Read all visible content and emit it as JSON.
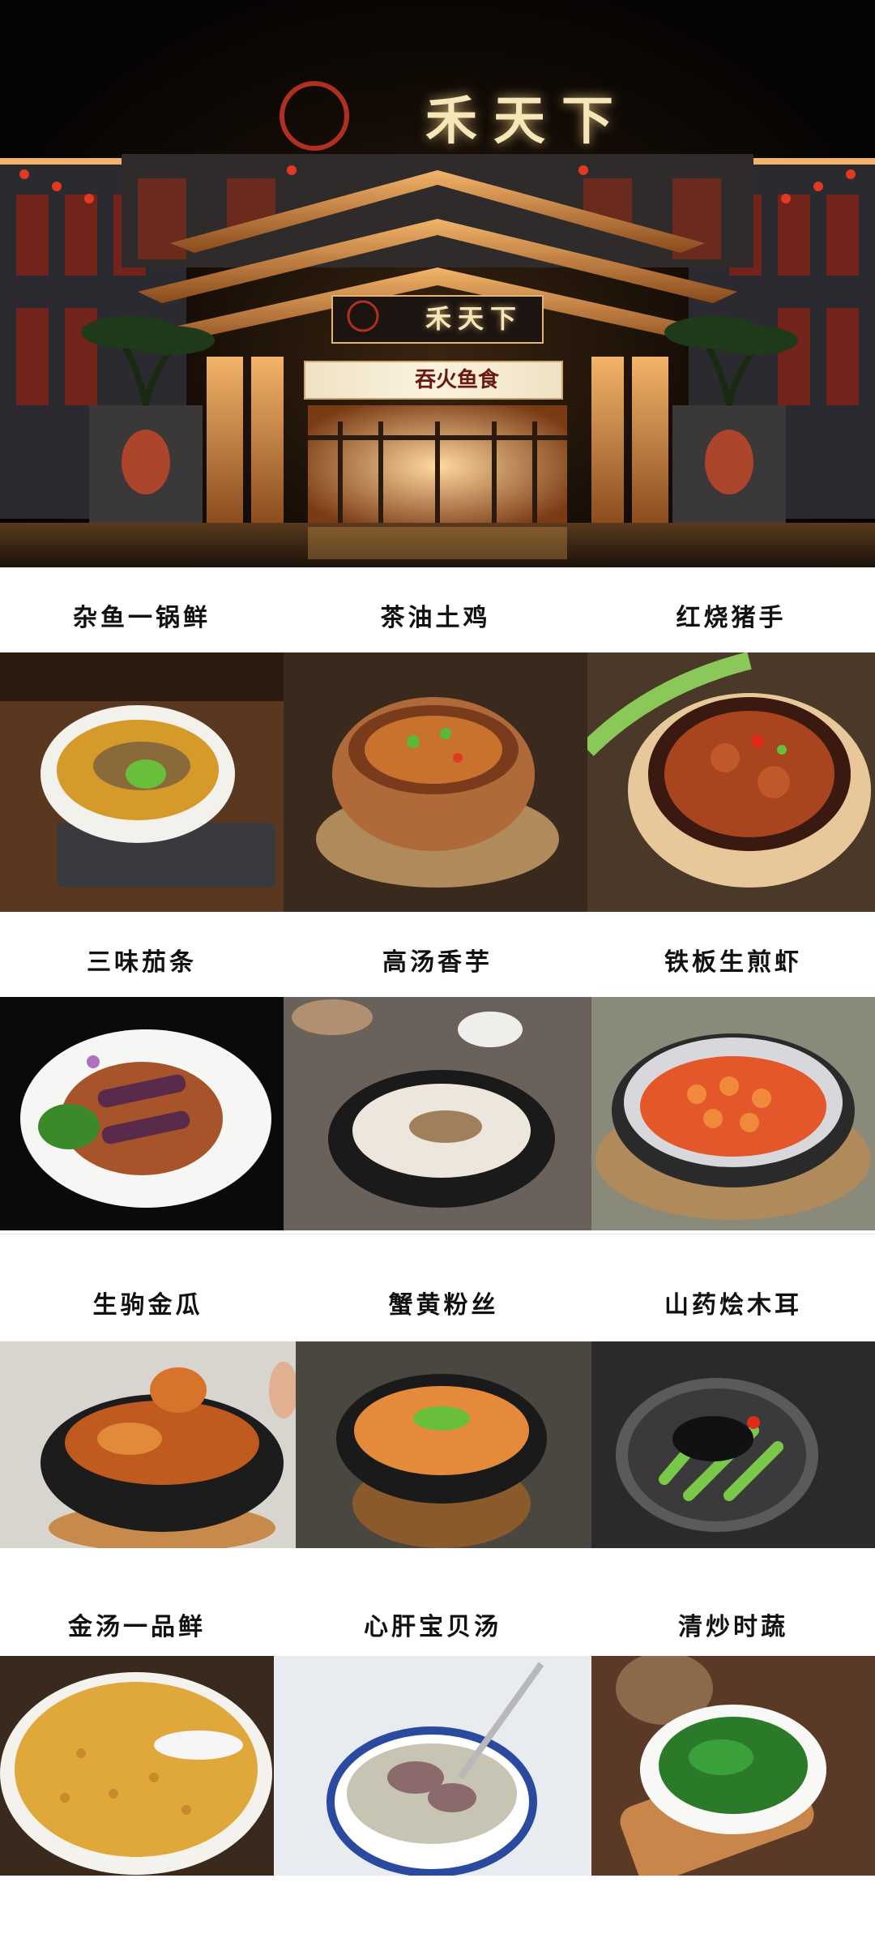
{
  "hero": {
    "logo_text": "禾天下",
    "sign_text": "禾天下",
    "banner_text": "吞火鱼食"
  },
  "dishes": [
    {
      "name": "杂鱼一锅鲜",
      "icon": "fish-stew-pot-icon"
    },
    {
      "name": "茶油土鸡",
      "icon": "clay-pot-chicken-icon"
    },
    {
      "name": "红烧猪手",
      "icon": "braised-pork-knuckle-icon"
    },
    {
      "name": "三味茄条",
      "icon": "eggplant-plate-icon"
    },
    {
      "name": "高汤香芋",
      "icon": "taro-soup-pot-icon"
    },
    {
      "name": "铁板生煎虾",
      "icon": "sizzling-shrimp-plate-icon"
    },
    {
      "name": "生驹金瓜",
      "icon": "pumpkin-pot-icon"
    },
    {
      "name": "蟹黄粉丝",
      "icon": "crab-vermicelli-pot-icon"
    },
    {
      "name": "山药烩木耳",
      "icon": "yam-fungus-plate-icon"
    },
    {
      "name": "金汤一品鲜",
      "icon": "golden-soup-bowl-icon"
    },
    {
      "name": "心肝宝贝汤",
      "icon": "liver-soup-bowl-icon"
    },
    {
      "name": "清炒时蔬",
      "icon": "stir-fried-greens-bowl-icon"
    }
  ]
}
